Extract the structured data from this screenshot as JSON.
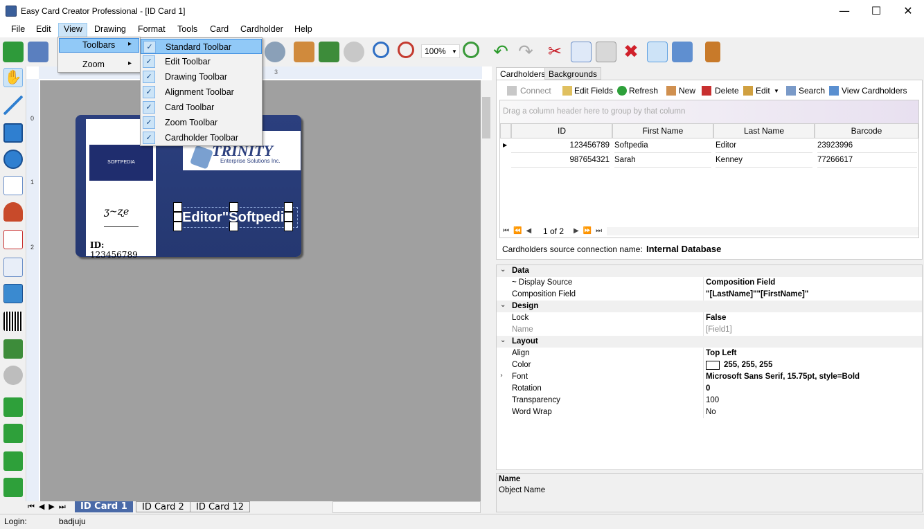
{
  "window": {
    "title": "Easy Card Creator Professional - [ID Card 1]",
    "minimize": "—",
    "maximize": "☐",
    "close": "✕"
  },
  "menu": [
    "File",
    "Edit",
    "View",
    "Drawing",
    "Format",
    "Tools",
    "Card",
    "Cardholder",
    "Help"
  ],
  "view_menu": {
    "items": [
      {
        "label": "Toolbars",
        "arrow": "▸"
      },
      {
        "label": "Zoom",
        "arrow": "▸"
      }
    ]
  },
  "toolbars_menu": {
    "items": [
      "Standard Toolbar",
      "Edit Toolbar",
      "Drawing Toolbar",
      "Alignment Toolbar",
      "Card Toolbar",
      "Zoom Toolbar",
      "Cardholder Toolbar"
    ],
    "check": "✓"
  },
  "toolbar": {
    "zoom": "100%"
  },
  "ruler": {
    "h_marks": [
      "3"
    ],
    "v_marks": [
      "0",
      "1",
      "2"
    ]
  },
  "card": {
    "company_logo_text": "SOFTPEDIA",
    "trinity_title": "TRINITY",
    "trinity_sub": "Enterprise Solutions Inc.",
    "name_field": "Editor\"Softpedia",
    "id_label": "ID:",
    "id_value": "123456789"
  },
  "card_tabs": [
    "ID Card 1",
    "ID Card 2",
    "ID Card 12"
  ],
  "status": {
    "login_label": "Login:",
    "login_value": "badjuju"
  },
  "right_tabs": [
    "Cardholders",
    "Backgrounds"
  ],
  "cardholders_toolbar": {
    "connect": "Connect",
    "edit_fields": "Edit Fields",
    "refresh": "Refresh",
    "new": "New",
    "delete": "Delete",
    "edit": "Edit",
    "search": "Search",
    "view": "View Cardholders"
  },
  "grid": {
    "group_hint": "Drag a column header here to group by that column",
    "columns": [
      "ID",
      "First Name",
      "Last Name",
      "Barcode"
    ],
    "rows": [
      [
        "123456789",
        "Softpedia",
        "Editor",
        "23923996"
      ],
      [
        "987654321",
        "Sarah",
        "Kenney",
        "77266617"
      ]
    ],
    "pager": "1 of 2"
  },
  "source": {
    "label": "Cardholders source connection name:",
    "value": "Internal Database"
  },
  "properties": [
    {
      "cat": true,
      "k": "Data"
    },
    {
      "k": "~ Display Source",
      "v": "Composition Field",
      "bold": true
    },
    {
      "k": "Composition Field",
      "v": "\"[LastName]\"\"[FirstName]\"",
      "bold": true
    },
    {
      "cat": true,
      "k": "Design"
    },
    {
      "k": "Lock",
      "v": "False",
      "bold": true
    },
    {
      "k": "Name",
      "v": "[Field1]",
      "dim": true
    },
    {
      "cat": true,
      "k": "Layout"
    },
    {
      "k": "Align",
      "v": "Top Left",
      "bold": true
    },
    {
      "k": "Color",
      "v": "255, 255, 255",
      "bold": true,
      "swatch": "#ffffff"
    },
    {
      "k": "Font",
      "v": "Microsoft Sans Serif, 15.75pt, style=Bold",
      "bold": true,
      "expand": true
    },
    {
      "k": "Rotation",
      "v": "0",
      "bold": true
    },
    {
      "k": "Transparency",
      "v": "100"
    },
    {
      "k": "Word Wrap",
      "v": "No"
    }
  ],
  "name_panel": {
    "title": "Name",
    "desc": "Object Name"
  }
}
